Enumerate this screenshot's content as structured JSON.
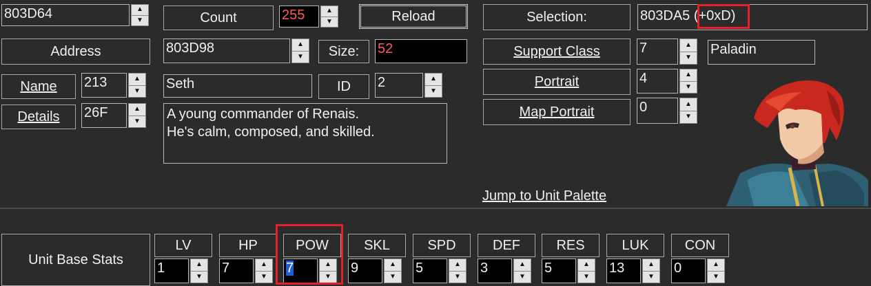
{
  "top": {
    "address_value": "803D64",
    "count_label": "Count",
    "count_value": "255",
    "reload_label": "Reload",
    "selection_label": "Selection:",
    "selection_value": "803DA5",
    "selection_offset": "(+0xD)"
  },
  "record": {
    "address_label": "Address",
    "address_value": "803D98",
    "size_label": "Size:",
    "size_value": "52"
  },
  "name_row": {
    "name_label": "Name",
    "name_id": "213",
    "name_text": "Seth",
    "id_label": "ID",
    "id_value": "2"
  },
  "details_row": {
    "details_label": "Details",
    "details_id": "26F",
    "details_line1": "A young commander of Renais.",
    "details_line2": "He's calm, composed, and skilled."
  },
  "right_panel": {
    "support_class_label": "Support Class",
    "support_class_value": "7",
    "support_class_name": "Paladin",
    "portrait_label": "Portrait",
    "portrait_value": "4",
    "map_portrait_label": "Map Portrait",
    "map_portrait_value": "0",
    "jump_link": "Jump to Unit Palette"
  },
  "stats": {
    "section_label": "Unit Base Stats",
    "items": [
      {
        "label": "LV",
        "value": "1"
      },
      {
        "label": "HP",
        "value": "7"
      },
      {
        "label": "POW",
        "value": "7"
      },
      {
        "label": "SKL",
        "value": "9"
      },
      {
        "label": "SPD",
        "value": "5"
      },
      {
        "label": "DEF",
        "value": "3"
      },
      {
        "label": "RES",
        "value": "5"
      },
      {
        "label": "LUK",
        "value": "13"
      },
      {
        "label": "CON",
        "value": "0"
      }
    ]
  },
  "colors": {
    "background": "#2b2b2b",
    "highlight_box": "#e4202a",
    "modified_value": "#ff5a5a",
    "selection": "#1e5fd8"
  },
  "icons": {
    "spinner_up": "chevron-up-icon",
    "spinner_down": "chevron-down-icon"
  }
}
